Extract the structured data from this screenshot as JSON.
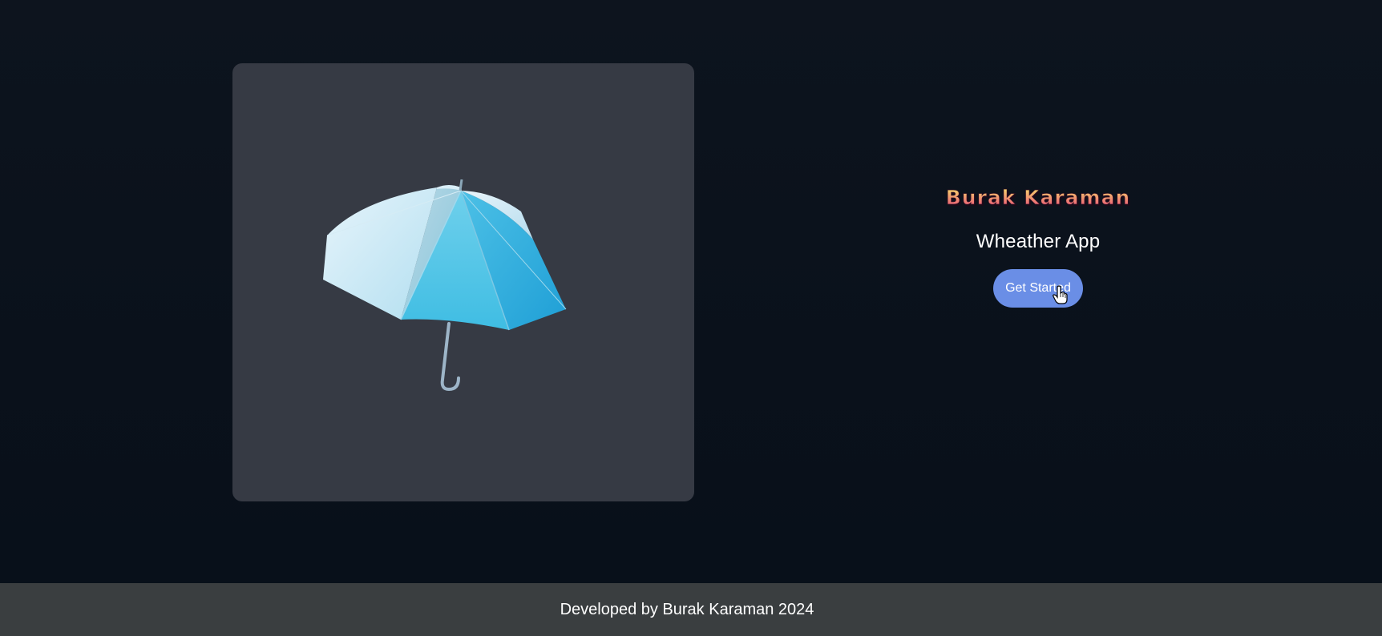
{
  "hero": {
    "logo_text": "Burak Karaman",
    "subtitle": "Wheather App",
    "cta_label": "Get Started"
  },
  "image": {
    "icon": "umbrella-icon"
  },
  "footer": {
    "text": "Developed by Burak Karaman 2024"
  },
  "colors": {
    "background": "#0b121c",
    "card": "#363a44",
    "button": "#6a8ee6",
    "footer": "#3a3e40",
    "logo_gradient_top": "#f5e76b",
    "logo_gradient_bottom": "#e8457a"
  }
}
